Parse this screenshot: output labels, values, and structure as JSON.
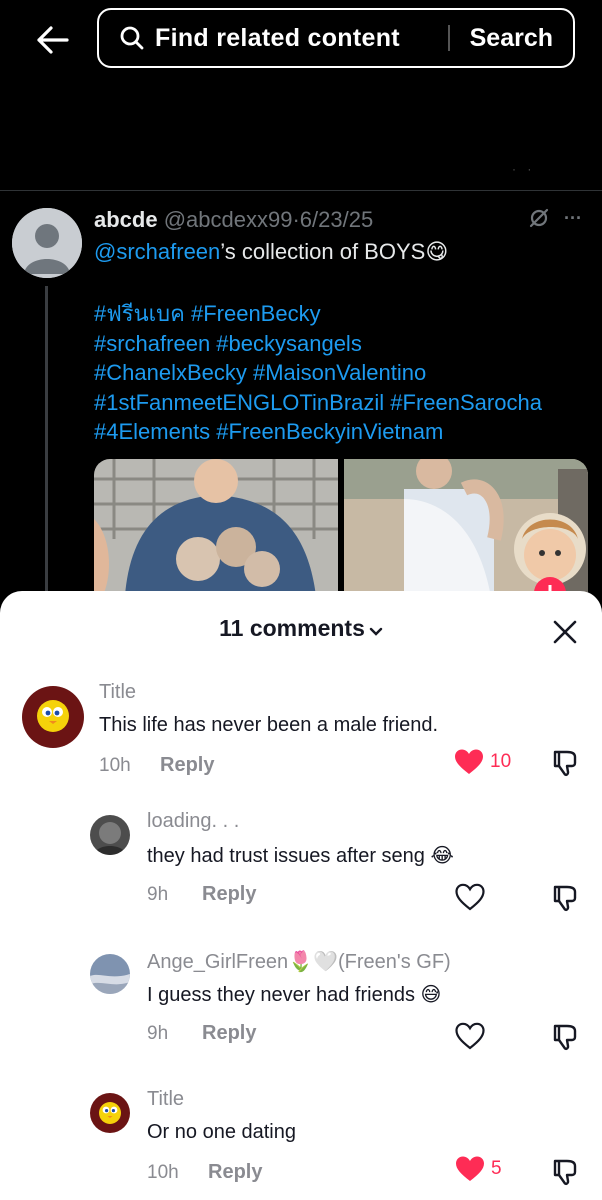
{
  "header": {
    "search_placeholder": "Find related content",
    "search_button": "Search"
  },
  "tweet": {
    "name": "abcde",
    "handle": "@abcdexx99",
    "sep": "·",
    "date": "6/23/25",
    "mention": "@srchafreen",
    "text": "’s collection of BOYS",
    "emoji": "😋",
    "hashtag_lines": [
      "#ฟรีนเบค #FreenBecky",
      "#srchafreen #beckysangels",
      "#ChanelxBecky #MaisonValentino",
      "#1stFanmeetENGLOTinBrazil #FreenSarocha",
      "#4Elements #FreenBeckyinVietnam"
    ],
    "more_label": "···"
  },
  "comments_panel": {
    "title": "11 comments",
    "comments": [
      {
        "user": "Title",
        "text": "This life has never been a male friend.",
        "time": "10h",
        "reply": "Reply",
        "likes": "10",
        "liked": true
      },
      {
        "user": "loading. . .",
        "text": "they had trust issues after seng",
        "emoji": "😂",
        "time": "9h",
        "reply": "Reply",
        "likes": "",
        "liked": false
      },
      {
        "user": "Ange_GirlFreen",
        "user_emoji": "🌷🤍",
        "user_suffix": "(Freen's GF)",
        "text": "I guess they never had friends",
        "emoji": "😅",
        "time": "9h",
        "reply": "Reply",
        "likes": "",
        "liked": false
      },
      {
        "user": "Title",
        "text": "Or no one dating",
        "time": "10h",
        "reply": "Reply",
        "likes": "5",
        "liked": true
      }
    ]
  },
  "colors": {
    "link_blue": "#1d9bf0",
    "like_red": "#fe2c55",
    "muted_gray": "#8a8b91"
  }
}
